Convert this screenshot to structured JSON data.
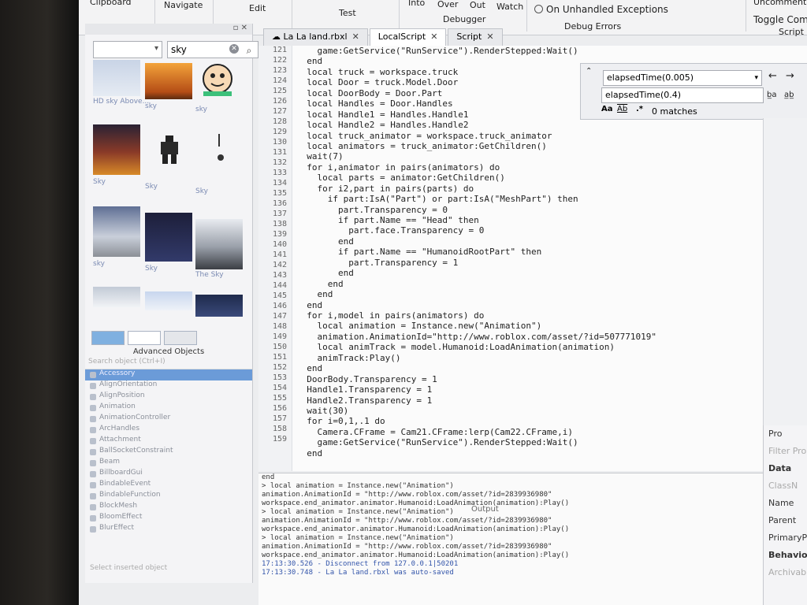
{
  "ribbon": {
    "clipboard": "Clipboard",
    "navigate": "Navigate",
    "edit": "Edit",
    "test": "Test",
    "into": "Into",
    "over": "Over",
    "out": "Out",
    "watch": "Watch",
    "debugger": "Debugger",
    "on_unhandled": "On Unhandled Exceptions",
    "debug_errors": "Debug Errors",
    "uncomment": "Uncomment",
    "toggle_comment": "Toggle Comm",
    "script": "Script"
  },
  "toolbox": {
    "dropdown_value": "",
    "search_value": "sky",
    "items": [
      {
        "label": "HD sky Above..."
      },
      {
        "label": "sky"
      },
      {
        "label": "sky"
      },
      {
        "label": "Sky"
      },
      {
        "label": "Sky"
      },
      {
        "label": "Sky"
      },
      {
        "label": "sky"
      },
      {
        "label": "Sky"
      },
      {
        "label": "The Sky"
      }
    ]
  },
  "advanced_objects": {
    "title": "Advanced Objects",
    "search_placeholder": "Search object (Ctrl+I)",
    "items": [
      "Accessory",
      "AlignOrientation",
      "AlignPosition",
      "Animation",
      "AnimationController",
      "ArcHandles",
      "Attachment",
      "BallSocketConstraint",
      "Beam",
      "BillboardGui",
      "BindableEvent",
      "BindableFunction",
      "BlockMesh",
      "BloomEffect",
      "BlurEffect"
    ],
    "footer": "Select inserted object"
  },
  "tabs": [
    {
      "label": "La La land.rbxl",
      "active": false
    },
    {
      "label": "LocalScript",
      "active": true
    },
    {
      "label": "Script",
      "active": false
    }
  ],
  "editor": {
    "lines": [
      {
        "n": "121",
        "t": "    game:GetService(\"RunService\").RenderStepped:Wait()"
      },
      {
        "n": "122",
        "t": "  end"
      },
      {
        "n": "123",
        "t": "  local truck = workspace.truck"
      },
      {
        "n": "124",
        "t": "  local Door = truck.Model.Door"
      },
      {
        "n": "125",
        "t": "  local DoorBody = Door.Part"
      },
      {
        "n": "126",
        "t": "  local Handles = Door.Handles"
      },
      {
        "n": "127",
        "t": "  local Handle1 = Handles.Handle1"
      },
      {
        "n": "128",
        "t": "  local Handle2 = Handles.Handle2"
      },
      {
        "n": "129",
        "t": "  local truck_animator = workspace.truck_animator"
      },
      {
        "n": "130",
        "t": "  local animators = truck_animator:GetChildren()"
      },
      {
        "n": "131",
        "t": "  wait(7)"
      },
      {
        "n": "132",
        "t": "  for i,animator in pairs(animators) do"
      },
      {
        "n": "133",
        "t": "    local parts = animator:GetChildren()"
      },
      {
        "n": "134",
        "t": "    for i2,part in pairs(parts) do"
      },
      {
        "n": "135",
        "t": "      if part:IsA(\"Part\") or part:IsA(\"MeshPart\") then"
      },
      {
        "n": "136",
        "t": "        part.Transparency = 0"
      },
      {
        "n": "137",
        "t": "        if part.Name == \"Head\" then"
      },
      {
        "n": "138",
        "t": "          part.face.Transparency = 0"
      },
      {
        "n": "139",
        "t": "        end"
      },
      {
        "n": "140",
        "t": "        if part.Name == \"HumanoidRootPart\" then"
      },
      {
        "n": "141",
        "t": "          part.Transparency = 1"
      },
      {
        "n": "142",
        "t": "        end"
      },
      {
        "n": "143",
        "t": "      end"
      },
      {
        "n": "144",
        "t": "    end"
      },
      {
        "n": "145",
        "t": "  end"
      },
      {
        "n": "146",
        "t": "  for i,model in pairs(animators) do"
      },
      {
        "n": "147",
        "t": "    local animation = Instance.new(\"Animation\")"
      },
      {
        "n": "148",
        "t": "    animation.AnimationId=\"http://www.roblox.com/asset/?id=507771019\""
      },
      {
        "n": "149",
        "t": "    local animTrack = model.Humanoid:LoadAnimation(animation)"
      },
      {
        "n": "150",
        "t": "    animTrack:Play()"
      },
      {
        "n": "151",
        "t": "  end"
      },
      {
        "n": "152",
        "t": "  DoorBody.Transparency = 1"
      },
      {
        "n": "153",
        "t": "  Handle1.Transparency = 1"
      },
      {
        "n": "154",
        "t": "  Handle2.Transparency = 1"
      },
      {
        "n": "155",
        "t": "  wait(30)"
      },
      {
        "n": "156",
        "t": "  for i=0,1,.1 do"
      },
      {
        "n": "157",
        "t": "    Camera.CFrame = Cam21.CFrame:lerp(Cam22.CFrame,i)"
      },
      {
        "n": "158",
        "t": "    game:GetService(\"RunService\").RenderStepped:Wait()"
      },
      {
        "n": "159",
        "t": "  end"
      }
    ]
  },
  "find": {
    "find_value": "elapsedTime(0.005)",
    "replace_value": "elapsedTime(0.4)",
    "opt_case": "Aa",
    "opt_word": "Ab",
    "opt_regex": ".*",
    "matches": "0 matches"
  },
  "output": {
    "label": "Output",
    "lines": [
      {
        "t": "end",
        "c": ""
      },
      {
        "t": "> local animation = Instance.new(\"Animation\")",
        "c": ""
      },
      {
        "t": "animation.AnimationId = \"http://www.roblox.com/asset/?id=2839936980\"",
        "c": ""
      },
      {
        "t": "workspace.end_animator.animator.Humanoid:LoadAnimation(animation):Play()",
        "c": ""
      },
      {
        "t": "> local animation = Instance.new(\"Animation\")",
        "c": ""
      },
      {
        "t": "animation.AnimationId = \"http://www.roblox.com/asset/?id=2839936980\"",
        "c": ""
      },
      {
        "t": "workspace.end_animator.animator.Humanoid:LoadAnimation(animation):Play()",
        "c": ""
      },
      {
        "t": "> local animation = Instance.new(\"Animation\")",
        "c": ""
      },
      {
        "t": "animation.AnimationId = \"http://www.roblox.com/asset/?id=2839936980\"",
        "c": ""
      },
      {
        "t": "workspace.end_animator.animator.Humanoid:LoadAnimation(animation):Play()",
        "c": ""
      },
      {
        "t": "17:13:30.526 - Disconnect from 127.0.0.1|50201",
        "c": "blue"
      },
      {
        "t": "17:13:30.748 - La La land.rbxl was auto-saved",
        "c": "blue"
      }
    ]
  },
  "properties": {
    "title": "Pro",
    "filter_placeholder": "Filter Pro",
    "rows": [
      {
        "t": "Data",
        "kind": "hdr"
      },
      {
        "t": "ClassN",
        "kind": "muted"
      },
      {
        "t": "Name",
        "kind": ""
      },
      {
        "t": "Parent",
        "kind": ""
      },
      {
        "t": "PrimaryPa",
        "kind": ""
      },
      {
        "t": "Behavior",
        "kind": "hdr"
      },
      {
        "t": "Archivable",
        "kind": "muted"
      }
    ]
  }
}
